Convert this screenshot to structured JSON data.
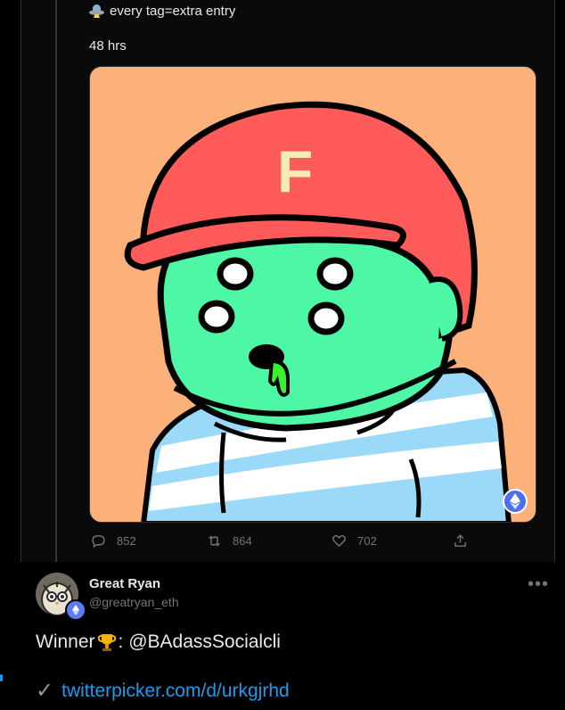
{
  "thread": {
    "entry_text": "every tag=extra entry",
    "duration_text": "48 hrs",
    "media": {
      "helmet_letter": "F",
      "background_color": "#fcb07a",
      "helmet_color": "#ff5b5a",
      "face_color": "#4ef7a5",
      "stripe_color": "#9ad9f7",
      "badge_icon": "ethereum-icon"
    },
    "actions": {
      "reply_count": "852",
      "retweet_count": "864",
      "like_count": "702"
    }
  },
  "reply_tweet": {
    "display_name": "Great Ryan",
    "handle": "@greatryan_eth",
    "winner_label": "Winner",
    "winner_suffix": ": @BAdassSocialcli",
    "check_glyph": "✓",
    "link_text": "twitterpicker.com/d/urkgjrhd",
    "more_glyph": "•••"
  },
  "colors": {
    "link": "#1d9bf0",
    "muted": "#71767b",
    "text": "#e7e9ea",
    "background": "#000000"
  }
}
